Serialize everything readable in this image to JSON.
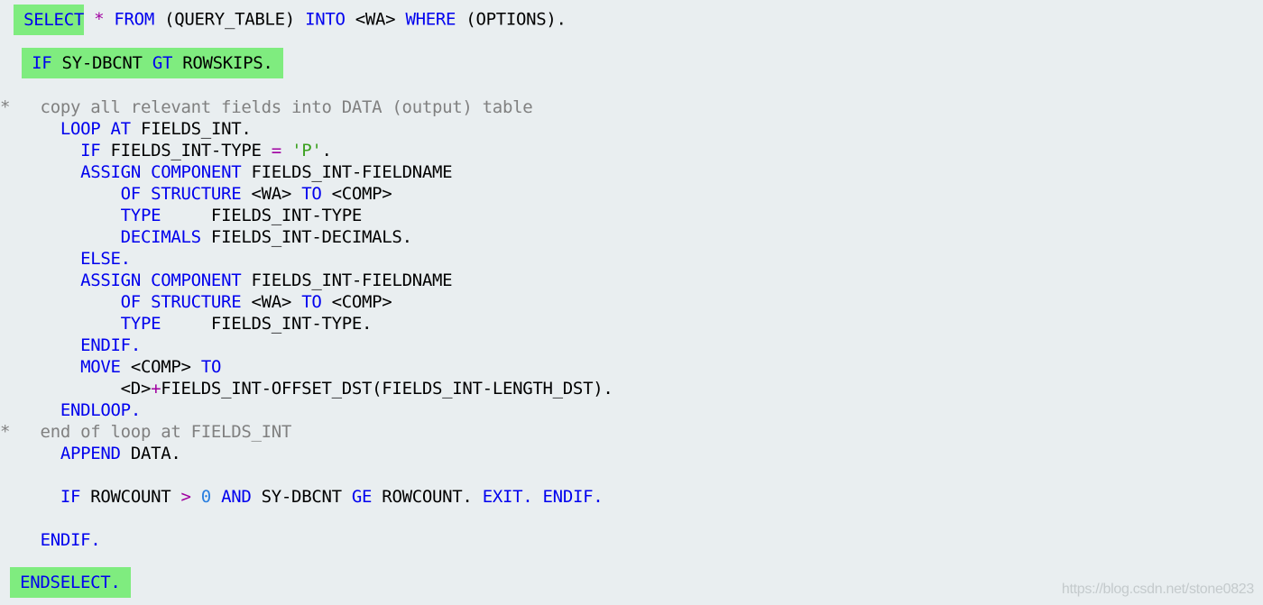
{
  "editor": {
    "language": "ABAP",
    "highlight_color": "#7fec7f",
    "background_color": "#e9eef0",
    "token_colors": {
      "kw": "#0000ee",
      "plain": "#000000",
      "op": "#a000a0",
      "str": "#3aa01e",
      "num": "#2a7fe0",
      "comment": "#808080"
    },
    "lines": [
      {
        "highlight": "first-token",
        "tokens": [
          {
            "t": " ",
            "c": "plain"
          },
          {
            "t": "SELECT",
            "c": "kw"
          },
          {
            "t": " ",
            "c": "plain"
          },
          {
            "t": "*",
            "c": "op"
          },
          {
            "t": " ",
            "c": "plain"
          },
          {
            "t": "FROM",
            "c": "kw"
          },
          {
            "t": " (QUERY_TABLE) ",
            "c": "plain"
          },
          {
            "t": "INTO",
            "c": "kw"
          },
          {
            "t": " <WA> ",
            "c": "plain"
          },
          {
            "t": "WHERE",
            "c": "kw"
          },
          {
            "t": " (OPTIONS).",
            "c": "plain"
          }
        ]
      },
      {
        "highlight": "line",
        "tokens": [
          {
            "t": " ",
            "c": "plain"
          },
          {
            "t": "IF",
            "c": "kw"
          },
          {
            "t": " SY-DBCNT ",
            "c": "plain"
          },
          {
            "t": "GT",
            "c": "kw"
          },
          {
            "t": " ROWSKIPS. ",
            "c": "plain"
          }
        ]
      },
      {
        "tokens": [
          {
            "t": "*   copy all relevant fields into DATA (output) table",
            "c": "comment"
          }
        ]
      },
      {
        "tokens": [
          {
            "t": "      ",
            "c": "plain"
          },
          {
            "t": "LOOP AT",
            "c": "kw"
          },
          {
            "t": " FIELDS_INT.",
            "c": "plain"
          }
        ]
      },
      {
        "tokens": [
          {
            "t": "        ",
            "c": "plain"
          },
          {
            "t": "IF",
            "c": "kw"
          },
          {
            "t": " FIELDS_INT-TYPE ",
            "c": "plain"
          },
          {
            "t": "=",
            "c": "op"
          },
          {
            "t": " ",
            "c": "plain"
          },
          {
            "t": "'P'",
            "c": "str"
          },
          {
            "t": ".",
            "c": "plain"
          }
        ]
      },
      {
        "tokens": [
          {
            "t": "        ",
            "c": "plain"
          },
          {
            "t": "ASSIGN COMPONENT",
            "c": "kw"
          },
          {
            "t": " FIELDS_INT-FIELDNAME",
            "c": "plain"
          }
        ]
      },
      {
        "tokens": [
          {
            "t": "            ",
            "c": "plain"
          },
          {
            "t": "OF STRUCTURE",
            "c": "kw"
          },
          {
            "t": " <WA> ",
            "c": "plain"
          },
          {
            "t": "TO",
            "c": "kw"
          },
          {
            "t": " <COMP>",
            "c": "plain"
          }
        ]
      },
      {
        "tokens": [
          {
            "t": "            ",
            "c": "plain"
          },
          {
            "t": "TYPE",
            "c": "kw"
          },
          {
            "t": "     FIELDS_INT-TYPE",
            "c": "plain"
          }
        ]
      },
      {
        "tokens": [
          {
            "t": "            ",
            "c": "plain"
          },
          {
            "t": "DECIMALS",
            "c": "kw"
          },
          {
            "t": " FIELDS_INT-DECIMALS.",
            "c": "plain"
          }
        ]
      },
      {
        "tokens": [
          {
            "t": "        ",
            "c": "plain"
          },
          {
            "t": "ELSE.",
            "c": "kw"
          }
        ]
      },
      {
        "tokens": [
          {
            "t": "        ",
            "c": "plain"
          },
          {
            "t": "ASSIGN COMPONENT",
            "c": "kw"
          },
          {
            "t": " FIELDS_INT-FIELDNAME",
            "c": "plain"
          }
        ]
      },
      {
        "tokens": [
          {
            "t": "            ",
            "c": "plain"
          },
          {
            "t": "OF STRUCTURE",
            "c": "kw"
          },
          {
            "t": " <WA> ",
            "c": "plain"
          },
          {
            "t": "TO",
            "c": "kw"
          },
          {
            "t": " <COMP>",
            "c": "plain"
          }
        ]
      },
      {
        "tokens": [
          {
            "t": "            ",
            "c": "plain"
          },
          {
            "t": "TYPE",
            "c": "kw"
          },
          {
            "t": "     FIELDS_INT-TYPE.",
            "c": "plain"
          }
        ]
      },
      {
        "tokens": [
          {
            "t": "        ",
            "c": "plain"
          },
          {
            "t": "ENDIF.",
            "c": "kw"
          }
        ]
      },
      {
        "tokens": [
          {
            "t": "        ",
            "c": "plain"
          },
          {
            "t": "MOVE",
            "c": "kw"
          },
          {
            "t": " <COMP> ",
            "c": "plain"
          },
          {
            "t": "TO",
            "c": "kw"
          }
        ]
      },
      {
        "tokens": [
          {
            "t": "            <D>",
            "c": "plain"
          },
          {
            "t": "+",
            "c": "op"
          },
          {
            "t": "FIELDS_INT-OFFSET_DST(FIELDS_INT-LENGTH_DST).",
            "c": "plain"
          }
        ]
      },
      {
        "tokens": [
          {
            "t": "      ",
            "c": "plain"
          },
          {
            "t": "ENDLOOP.",
            "c": "kw"
          }
        ]
      },
      {
        "tokens": [
          {
            "t": "*   end of loop at FIELDS_INT",
            "c": "comment"
          }
        ]
      },
      {
        "tokens": [
          {
            "t": "      ",
            "c": "plain"
          },
          {
            "t": "APPEND",
            "c": "kw"
          },
          {
            "t": " DATA.",
            "c": "plain"
          }
        ]
      },
      {
        "tokens": [
          {
            "t": "      ",
            "c": "plain"
          },
          {
            "t": "IF",
            "c": "kw"
          },
          {
            "t": " ROWCOUNT ",
            "c": "plain"
          },
          {
            "t": ">",
            "c": "op"
          },
          {
            "t": " ",
            "c": "plain"
          },
          {
            "t": "0",
            "c": "num"
          },
          {
            "t": " ",
            "c": "plain"
          },
          {
            "t": "AND",
            "c": "kw"
          },
          {
            "t": " SY-DBCNT ",
            "c": "plain"
          },
          {
            "t": "GE",
            "c": "kw"
          },
          {
            "t": " ROWCOUNT. ",
            "c": "plain"
          },
          {
            "t": "EXIT.",
            "c": "kw"
          },
          {
            "t": " ",
            "c": "plain"
          },
          {
            "t": "ENDIF.",
            "c": "kw"
          }
        ]
      },
      {
        "tokens": [
          {
            "t": "    ",
            "c": "plain"
          },
          {
            "t": "ENDIF.",
            "c": "kw"
          }
        ]
      },
      {
        "highlight": "line",
        "tokens": [
          {
            "t": " ",
            "c": "plain"
          },
          {
            "t": "ENDSELECT.",
            "c": "kw"
          },
          {
            "t": " ",
            "c": "plain"
          }
        ]
      }
    ]
  },
  "watermark": {
    "text": "https://blog.csdn.net/stone0823"
  }
}
